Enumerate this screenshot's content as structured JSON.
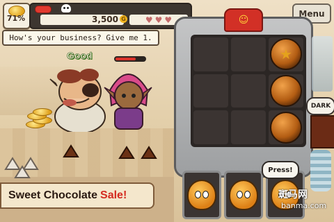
{
  "hud": {
    "percent": "71%",
    "score": "3,500",
    "currency_symbol": "G",
    "hearts": [
      "♥",
      "♥",
      "♥"
    ],
    "menu_label": "Menu"
  },
  "customer": {
    "speech": "How's your business? Give me 1.",
    "rating": "Good",
    "patience": 0.7
  },
  "machine": {
    "grid": [
      [
        "empty",
        "empty",
        "star"
      ],
      [
        "empty",
        "empty",
        "ball"
      ],
      [
        "empty",
        "empty",
        "ball"
      ]
    ],
    "dark_label": "DARK",
    "press_label": "Press!"
  },
  "banner": {
    "main": "Sweet Chocolate",
    "highlight": "Sale!"
  },
  "watermark": {
    "line1": "斑马网",
    "line2": "banma.com"
  },
  "colors": {
    "sale_red": "#d42b20",
    "good_green": "#3a7a1c",
    "machine_gray": "#9d9fa1"
  }
}
